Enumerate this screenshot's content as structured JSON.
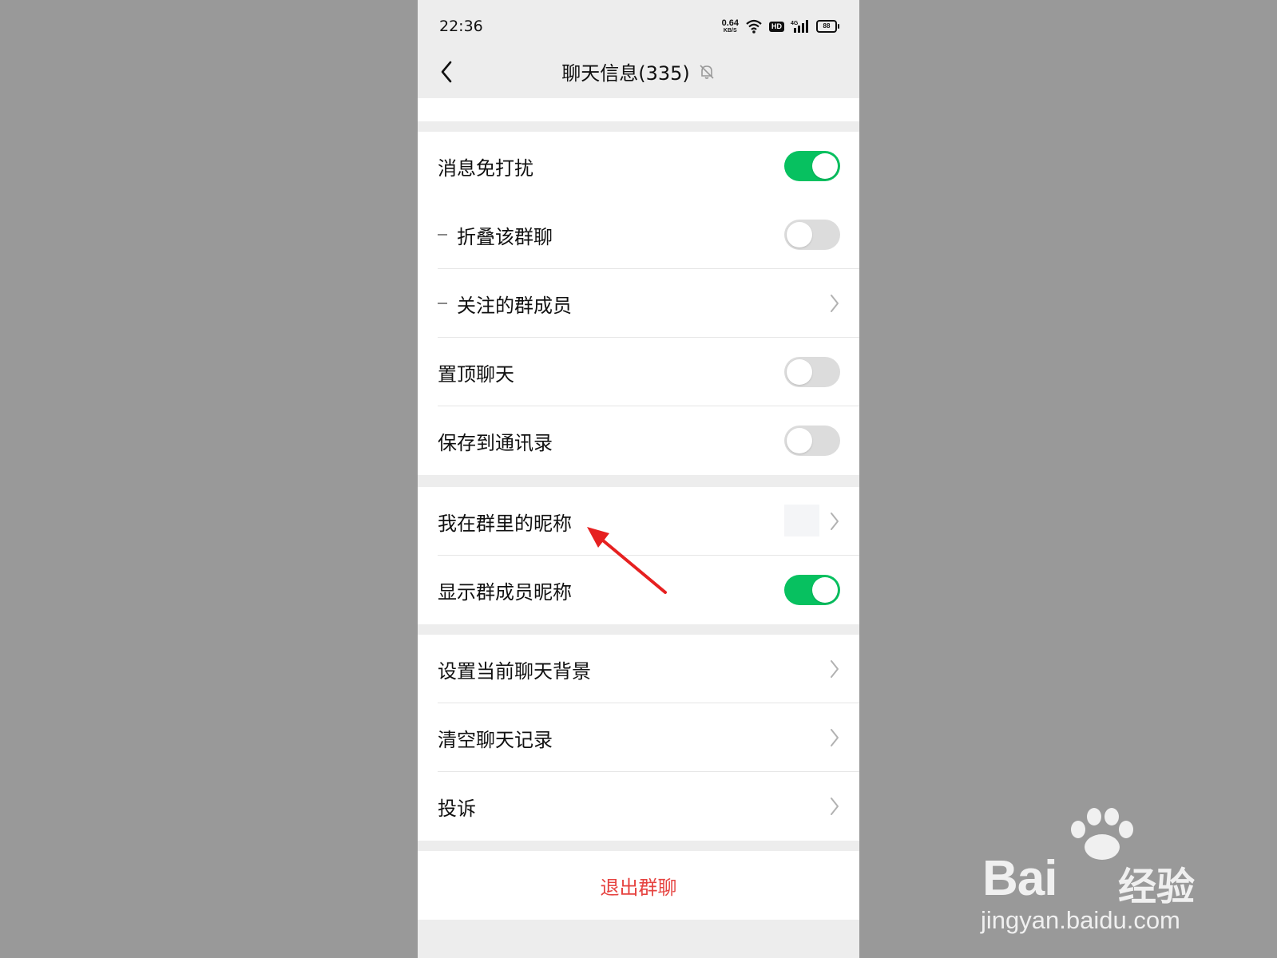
{
  "status_bar": {
    "time": "22:36",
    "net_speed_value": "0.64",
    "net_speed_unit": "KB/S",
    "hd": "HD",
    "network": "4G",
    "battery": "88"
  },
  "header": {
    "title": "聊天信息(335)",
    "back_icon": "chevron-left-icon",
    "mute_icon": "bell-off-icon"
  },
  "settings": {
    "group1": [
      {
        "label": "消息免打扰",
        "control": "toggle",
        "on": true
      },
      {
        "label": "折叠该群聊",
        "control": "toggle",
        "on": false,
        "sub": true
      },
      {
        "label": "关注的群成员",
        "control": "chevron",
        "sub": true
      },
      {
        "label": "置顶聊天",
        "control": "toggle",
        "on": false
      },
      {
        "label": "保存到通讯录",
        "control": "toggle",
        "on": false
      }
    ],
    "group2": [
      {
        "label": "我在群里的昵称",
        "control": "chevron"
      },
      {
        "label": "显示群成员昵称",
        "control": "toggle",
        "on": true
      }
    ],
    "group3": [
      {
        "label": "设置当前聊天背景",
        "control": "chevron"
      },
      {
        "label": "清空聊天记录",
        "control": "chevron"
      },
      {
        "label": "投诉",
        "control": "chevron"
      }
    ]
  },
  "exit_button": {
    "label": "退出群聊",
    "color": "#e64340"
  },
  "colors": {
    "toggle_on": "#07c160",
    "toggle_off": "#dcdcdc",
    "annotation_arrow": "#e62020"
  },
  "watermark": {
    "brand": "Bai",
    "brand_cn": "经验",
    "url": "jingyan.baidu.com"
  }
}
